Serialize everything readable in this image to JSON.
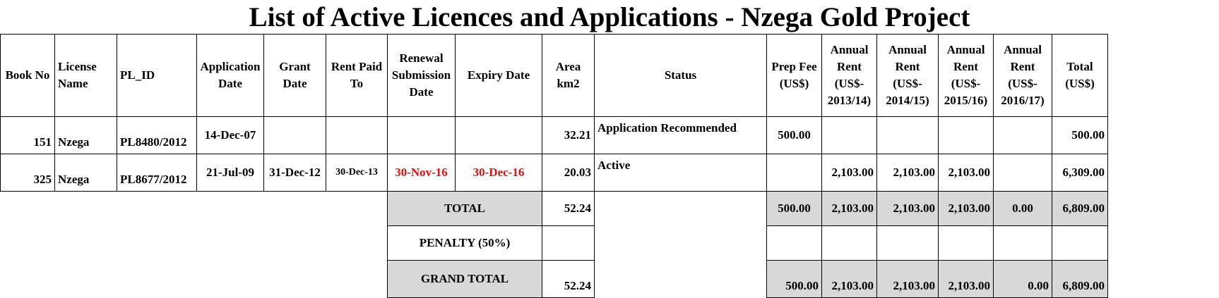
{
  "title": "List of Active Licences and Applications - Nzega Gold Project",
  "headers": {
    "book_no": "Book No",
    "license_name": "License Name",
    "pl_id": "PL_ID",
    "application_date": "Application Date",
    "grant_date": "Grant Date",
    "rent_paid_to": "Rent Paid To",
    "renewal_submission_date": "Renewal Submission Date",
    "expiry_date": "Expiry Date",
    "area": "Area km2",
    "status": "Status",
    "prep_fee": "Prep Fee (US$)",
    "rent_2013": "Annual Rent (US$- 2013/14)",
    "rent_2014": "Annual Rent (US$- 2014/15)",
    "rent_2015": "Annual Rent (US$- 2015/16)",
    "rent_2016": "Annual Rent (US$- 2016/17)",
    "total": "Total (US$)"
  },
  "rows": [
    {
      "book_no": "151",
      "license_name": "Nzega",
      "pl_id": "PL8480/2012",
      "application_date": "14-Dec-07",
      "grant_date": "",
      "rent_paid_to": "",
      "renewal_submission_date": "",
      "expiry_date": "",
      "area": "32.21",
      "status": "Application Recommended",
      "prep_fee": "500.00",
      "rent_2013": "",
      "rent_2014": "",
      "rent_2015": "",
      "rent_2016": "",
      "total": "500.00"
    },
    {
      "book_no": "325",
      "license_name": "Nzega",
      "pl_id": "PL8677/2012",
      "application_date": "21-Jul-09",
      "grant_date": "31-Dec-12",
      "rent_paid_to": "30-Dec-13",
      "renewal_submission_date": "30-Nov-16",
      "expiry_date": "30-Dec-16",
      "area": "20.03",
      "status": "Active",
      "prep_fee": "",
      "rent_2013": "2,103.00",
      "rent_2014": "2,103.00",
      "rent_2015": "2,103.00",
      "rent_2016": "",
      "total": "6,309.00"
    }
  ],
  "summary": {
    "total": {
      "label": "TOTAL",
      "area": "52.24",
      "prep_fee": "500.00",
      "rent_2013": "2,103.00",
      "rent_2014": "2,103.00",
      "rent_2015": "2,103.00",
      "rent_2016": "0.00",
      "total": "6,809.00"
    },
    "penalty": {
      "label": "PENALTY (50%)"
    },
    "grand_total": {
      "label": "GRAND TOTAL",
      "area": "52.24",
      "prep_fee": "500.00",
      "rent_2013": "2,103.00",
      "rent_2014": "2,103.00",
      "rent_2015": "2,103.00",
      "rent_2016": "0.00",
      "total": "6,809.00"
    }
  },
  "colors": {
    "shade": "#d8d8d8",
    "highlight_red": "#e01010"
  }
}
